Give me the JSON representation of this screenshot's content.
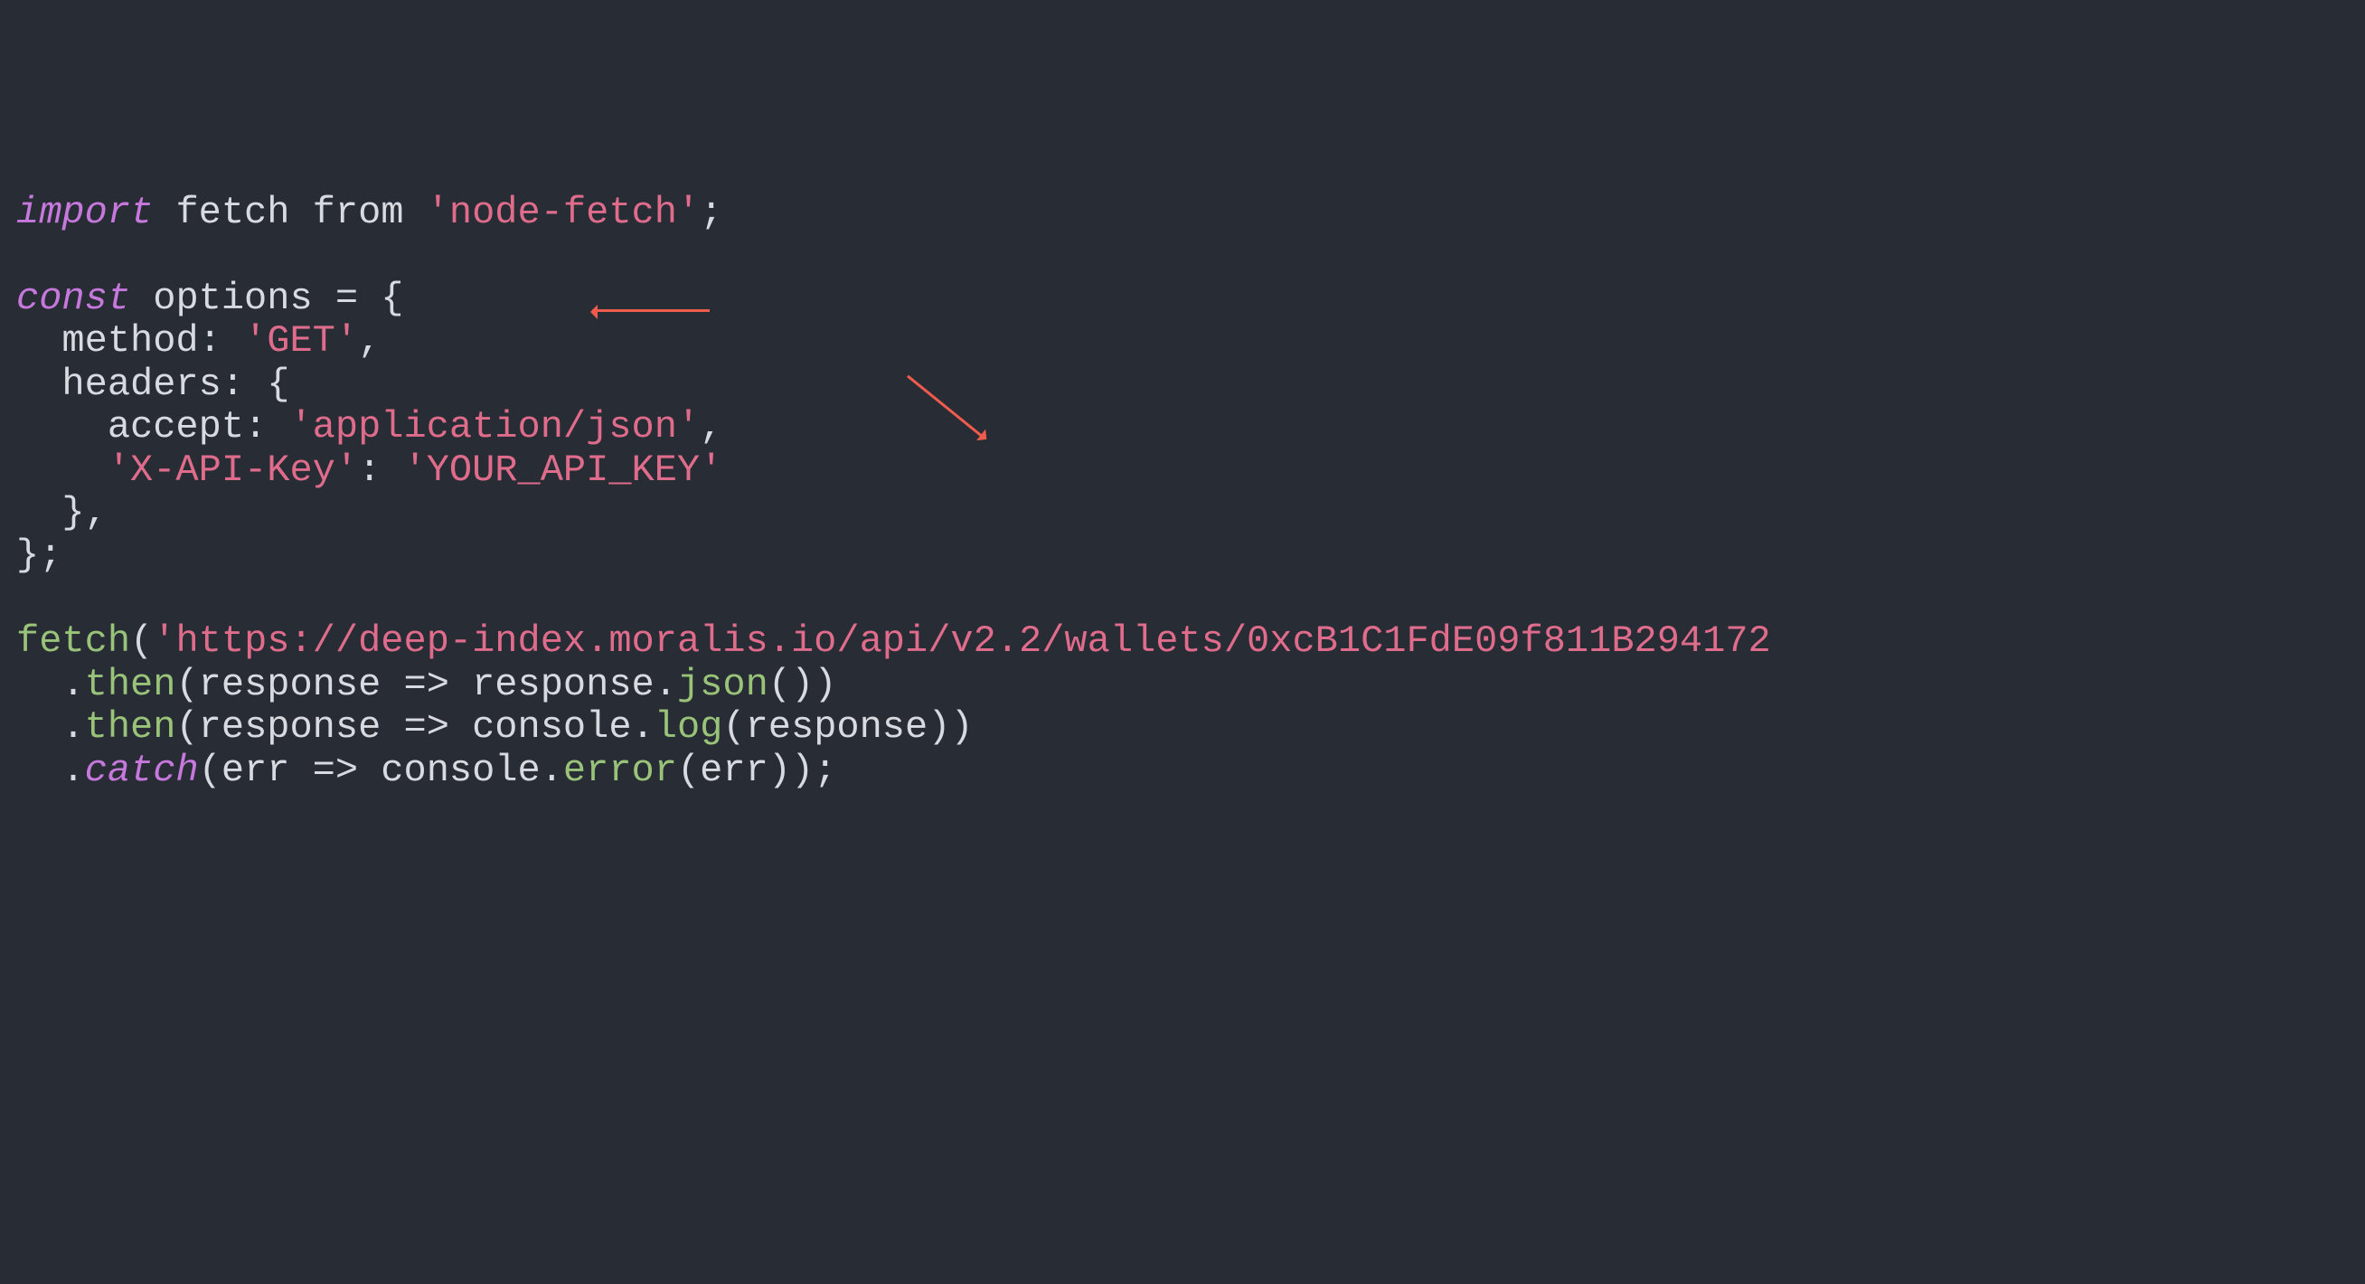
{
  "code": {
    "l1_kw_import": "import",
    "l1_rest": " fetch from ",
    "l1_str": "'node-fetch'",
    "l1_end": ";",
    "l3_kw_const": "const",
    "l3_rest": " options = {",
    "l4_prop": "  method: ",
    "l4_str": "'GET'",
    "l4_end": ",",
    "l5_prop": "  headers: {",
    "l6_prop": "    accept: ",
    "l6_str": "'application/json'",
    "l6_end": ",",
    "l7_key": "    'X-API-Key'",
    "l7_colon": ": ",
    "l7_val": "'YOUR_API_KEY'",
    "l8": "  },",
    "l9": "};",
    "l11_fn": "fetch",
    "l11_open": "(",
    "l11_str": "'https://deep-index.moralis.io/api/v2.2/wallets/0xcB1C1FdE09f811B294172",
    "l12_pre": "  .",
    "l12_fn": "then",
    "l12_post": "(response => response.",
    "l12_fn2": "json",
    "l12_end": "())",
    "l13_pre": "  .",
    "l13_fn": "then",
    "l13_post": "(response => console.",
    "l13_fn2": "log",
    "l13_end": "(response))",
    "l14_pre": "  .",
    "l14_kw": "catch",
    "l14_post": "(err => console.",
    "l14_fn2": "error",
    "l14_end": "(err));"
  }
}
